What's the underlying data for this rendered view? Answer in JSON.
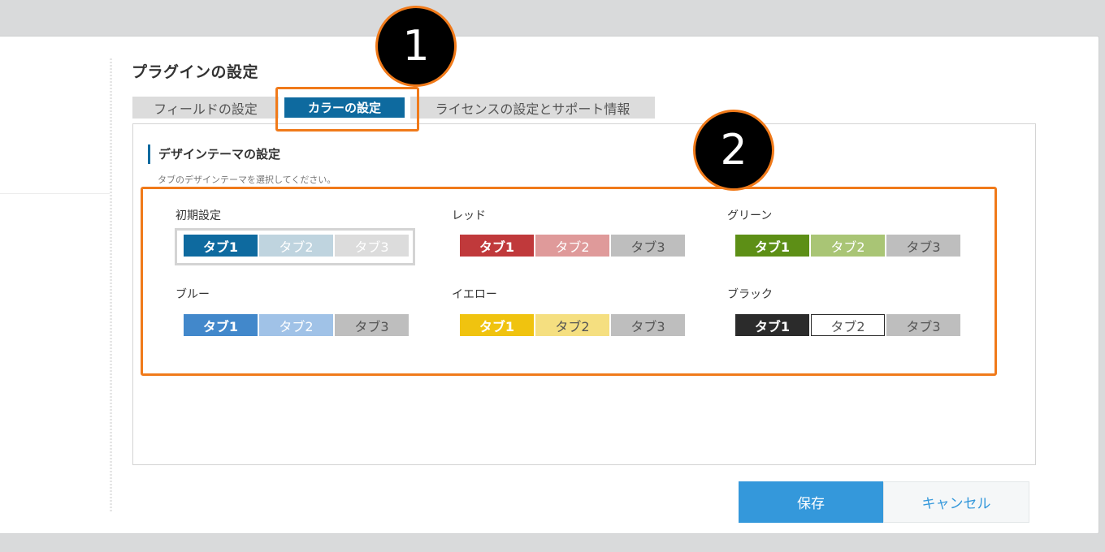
{
  "page": {
    "title": "プラグインの設定"
  },
  "tabs": [
    {
      "label": "フィールドの設定",
      "selected": false
    },
    {
      "label": "カラーの設定",
      "selected": true
    },
    {
      "label": "ライセンスの設定とサポート情報",
      "selected": false
    }
  ],
  "section": {
    "title": "デザインテーマの設定",
    "description": "タブのデザインテーマを選択してください。"
  },
  "themes": [
    {
      "name": "初期設定",
      "selected": true,
      "tabs": [
        "タブ1",
        "タブ2",
        "タブ3"
      ],
      "colors": {
        "active_bg": "#0e6a9f",
        "active_fg": "#ffffff",
        "second_bg": "#bfd4df",
        "second_fg": "#ffffff",
        "third_bg": "#dcdcdc",
        "third_fg": "#ffffff"
      }
    },
    {
      "name": "レッド",
      "selected": false,
      "tabs": [
        "タブ1",
        "タブ2",
        "タブ3"
      ],
      "colors": {
        "active_bg": "#c0393b",
        "active_fg": "#ffffff",
        "second_bg": "#df9a9a",
        "second_fg": "#ffffff",
        "third_bg": "#bebebe",
        "third_fg": "#555555"
      }
    },
    {
      "name": "グリーン",
      "selected": false,
      "tabs": [
        "タブ1",
        "タブ2",
        "タブ3"
      ],
      "colors": {
        "active_bg": "#5d8f16",
        "active_fg": "#ffffff",
        "second_bg": "#a9c575",
        "second_fg": "#ffffff",
        "third_bg": "#bebebe",
        "third_fg": "#555555"
      }
    },
    {
      "name": "ブルー",
      "selected": false,
      "tabs": [
        "タブ1",
        "タブ2",
        "タブ3"
      ],
      "colors": {
        "active_bg": "#4288cb",
        "active_fg": "#ffffff",
        "second_bg": "#a0c2e7",
        "second_fg": "#ffffff",
        "third_bg": "#bebebe",
        "third_fg": "#555555"
      }
    },
    {
      "name": "イエロー",
      "selected": false,
      "tabs": [
        "タブ1",
        "タブ2",
        "タブ3"
      ],
      "colors": {
        "active_bg": "#f0c30f",
        "active_fg": "#ffffff",
        "second_bg": "#f5df80",
        "second_fg": "#555555",
        "third_bg": "#bebebe",
        "third_fg": "#555555"
      }
    },
    {
      "name": "ブラック",
      "selected": false,
      "tabs": [
        "タブ1",
        "タブ2",
        "タブ3"
      ],
      "colors": {
        "active_bg": "#2b2b2b",
        "active_fg": "#ffffff",
        "second_bg": "#ffffff",
        "second_fg": "#555555",
        "third_bg": "#bebebe",
        "third_fg": "#555555"
      }
    }
  ],
  "annotations": [
    "1",
    "2"
  ],
  "annotation_color": "#f07a1a",
  "buttons": {
    "save": "保存",
    "cancel": "キャンセル"
  },
  "colors": {
    "accent": "#0e6a9f",
    "save_button": "#3498db"
  }
}
